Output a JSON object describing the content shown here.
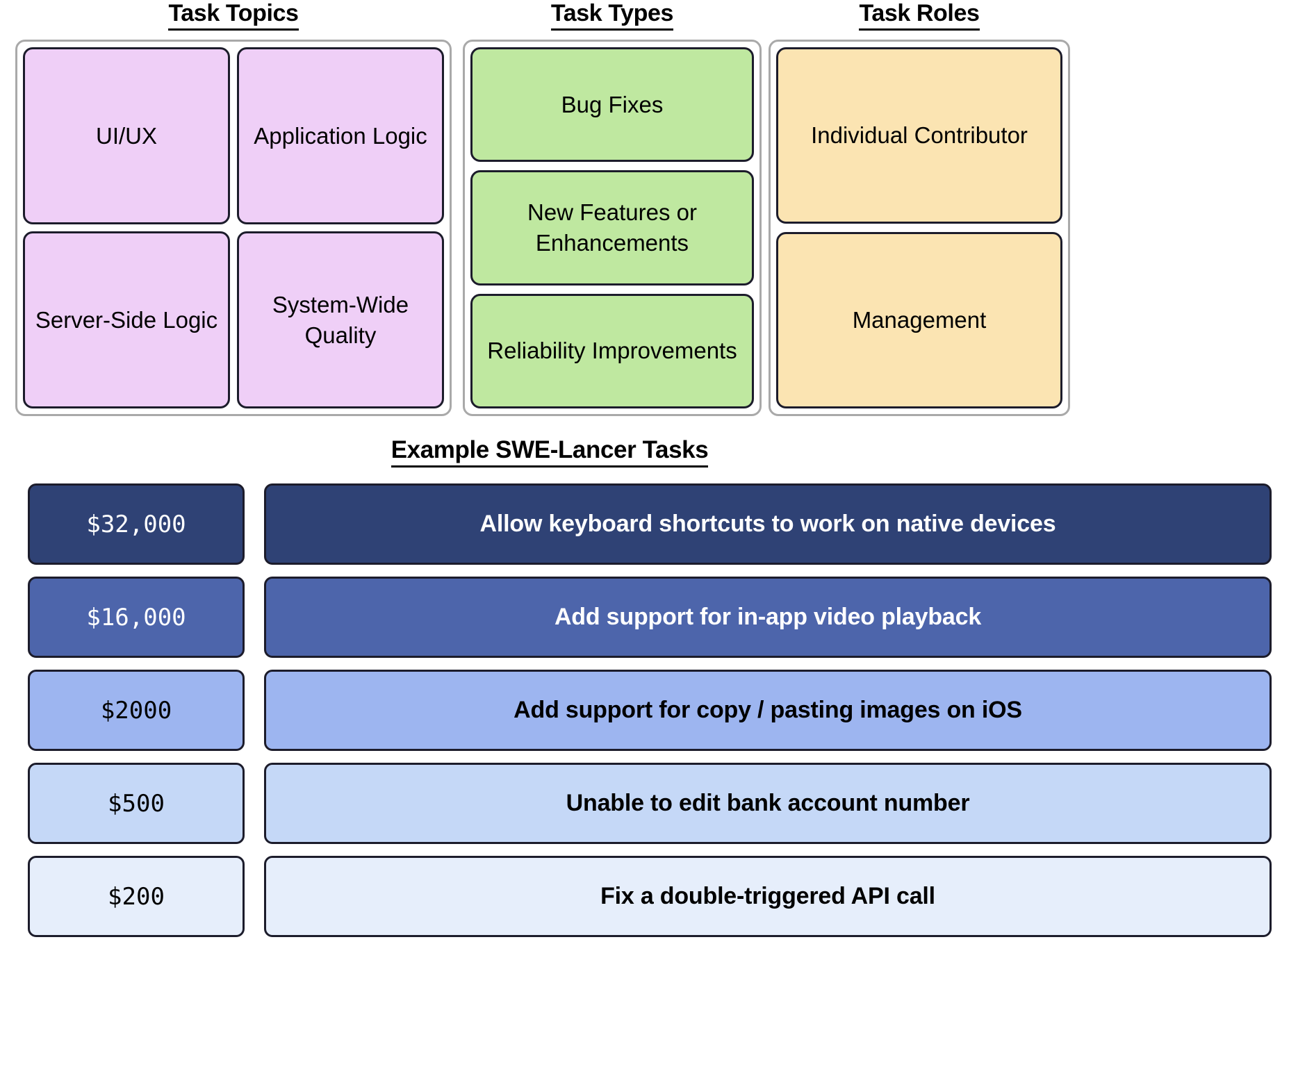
{
  "columns": [
    {
      "heading": "Task Topics",
      "color": "#efcff7",
      "items": [
        "UI/UX",
        "Application Logic",
        "Server-Side Logic",
        "System-Wide Quality"
      ]
    },
    {
      "heading": "Task Types",
      "color": "#bfe8a0",
      "items": [
        "Bug Fixes",
        "New Features or Enhancements",
        "Reliability Improvements"
      ]
    },
    {
      "heading": "Task Roles",
      "color": "#fbe4b2",
      "items": [
        "Individual Contributor",
        "Management"
      ]
    }
  ],
  "examples": {
    "heading": "Example SWE-Lancer Tasks",
    "rows": [
      {
        "price": "$32,000",
        "task": "Allow keyboard shortcuts to work on native devices",
        "bg": "#2f4275",
        "text": "#ffffff"
      },
      {
        "price": "$16,000",
        "task": "Add support for in-app video playback",
        "bg": "#4d65ab",
        "text": "#ffffff"
      },
      {
        "price": "$2000",
        "task": "Add support for copy / pasting images on iOS",
        "bg": "#9db5f0",
        "text": "#000000"
      },
      {
        "price": "$500",
        "task": "Unable to edit bank account number",
        "bg": "#c5d8f7",
        "text": "#000000"
      },
      {
        "price": "$200",
        "task": "Fix a double-triggered API call",
        "bg": "#e6eefb",
        "text": "#000000"
      }
    ]
  }
}
